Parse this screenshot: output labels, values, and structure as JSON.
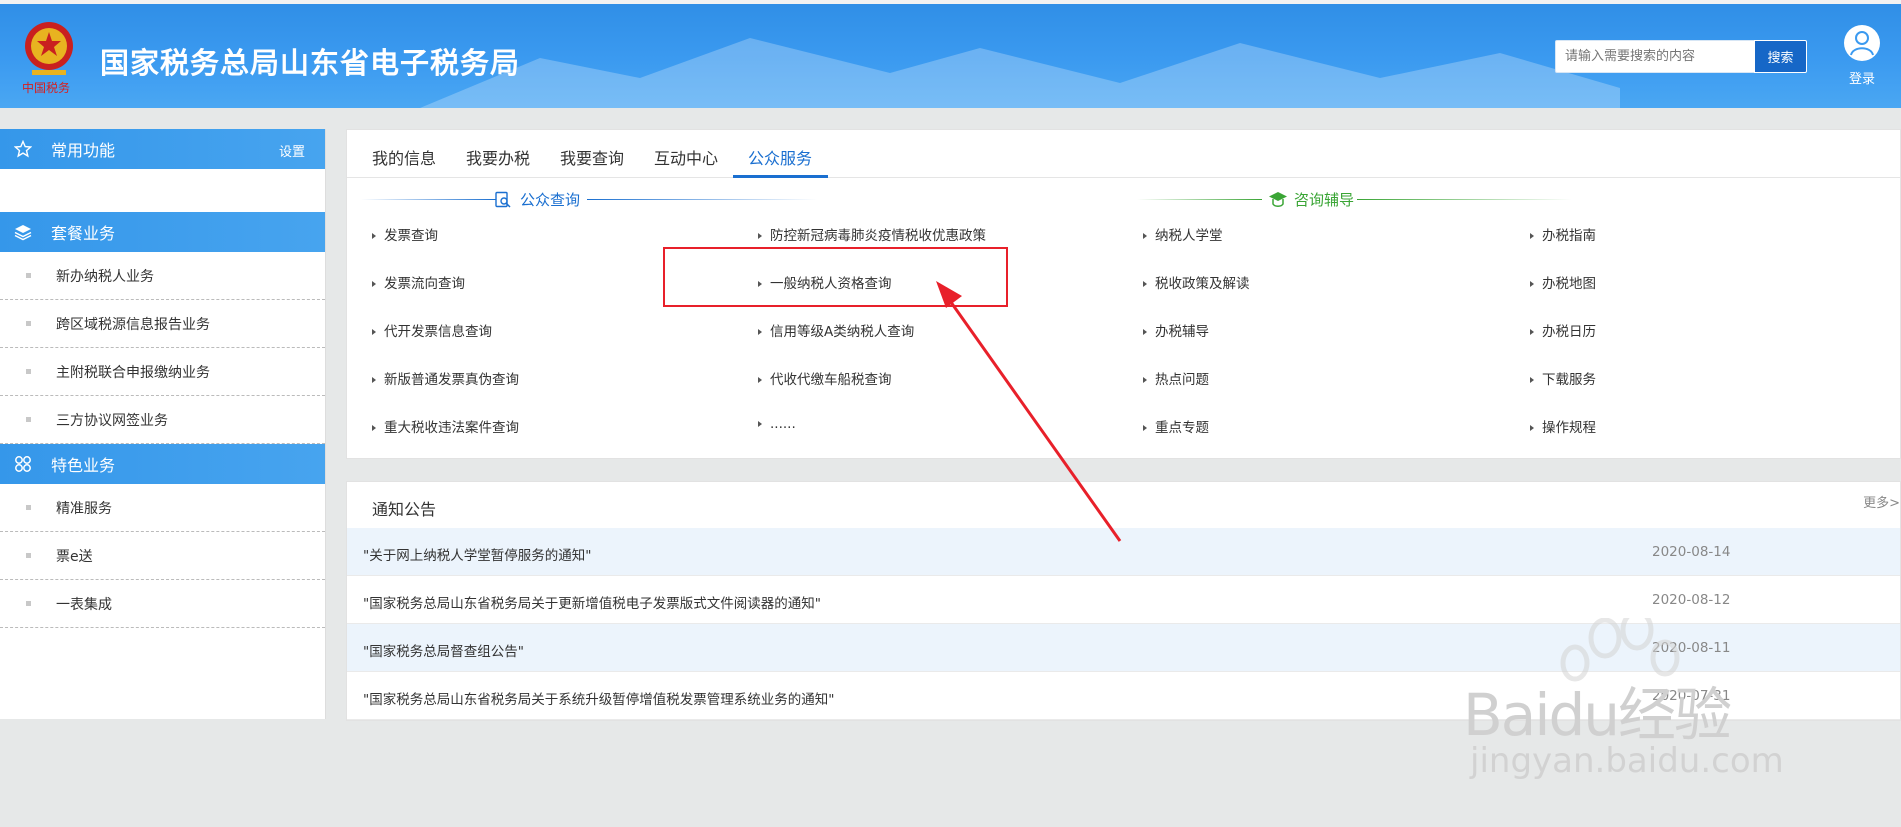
{
  "header": {
    "site_title": "国家税务总局山东省电子税务局",
    "search_placeholder": "请输入需要搜索的内容",
    "search_button": "搜索",
    "login_label": "登录"
  },
  "sidebar": {
    "common": {
      "title": "常用功能",
      "setting": "设置"
    },
    "package": {
      "title": "套餐业务",
      "items": [
        "新办纳税人业务",
        "跨区域税源信息报告业务",
        "主附税联合申报缴纳业务",
        "三方协议网签业务"
      ]
    },
    "featured": {
      "title": "特色业务",
      "items": [
        "精准服务",
        "票e送",
        "一表集成"
      ]
    }
  },
  "main": {
    "tabs": [
      "我的信息",
      "我要办税",
      "我要查询",
      "互动中心",
      "公众服务"
    ],
    "active_tab": "公众服务",
    "public_query": {
      "title": "公众查询",
      "col1": [
        "发票查询",
        "发票流向查询",
        "代开发票信息查询",
        "新版普通发票真伪查询",
        "重大税收违法案件查询"
      ],
      "col2": [
        "防控新冠病毒肺炎疫情税收优惠政策",
        "一般纳税人资格查询",
        "信用等级A类纳税人查询",
        "代收代缴车船税查询",
        "......"
      ]
    },
    "consult": {
      "title": "咨询辅导",
      "col1": [
        "纳税人学堂",
        "税收政策及解读",
        "办税辅导",
        "热点问题",
        "重点专题"
      ],
      "col2": [
        "办税指南",
        "办税地图",
        "办税日历",
        "下载服务",
        "操作规程"
      ]
    }
  },
  "notice": {
    "title": "通知公告",
    "more": "更多>",
    "rows": [
      {
        "title": "\"关于网上纳税人学堂暂停服务的通知\"",
        "date": "2020-08-14"
      },
      {
        "title": "\"国家税务总局山东省税务局关于更新增值税电子发票版式文件阅读器的通知\"",
        "date": "2020-08-12"
      },
      {
        "title": "\"国家税务总局督查组公告\"",
        "date": "2020-08-11"
      },
      {
        "title": "\"国家税务总局山东省税务局关于系统升级暂停增值税发票管理系统业务的通知\"",
        "date": "2020-07-31"
      }
    ]
  },
  "watermark": {
    "brand": "Baidu经验",
    "url": "jingyan.baidu.com"
  },
  "colors": {
    "header_blue": "#3b9af0",
    "accent": "#1a6fd0",
    "annotation_red": "#e8202a",
    "consult_green": "#3aa535"
  }
}
